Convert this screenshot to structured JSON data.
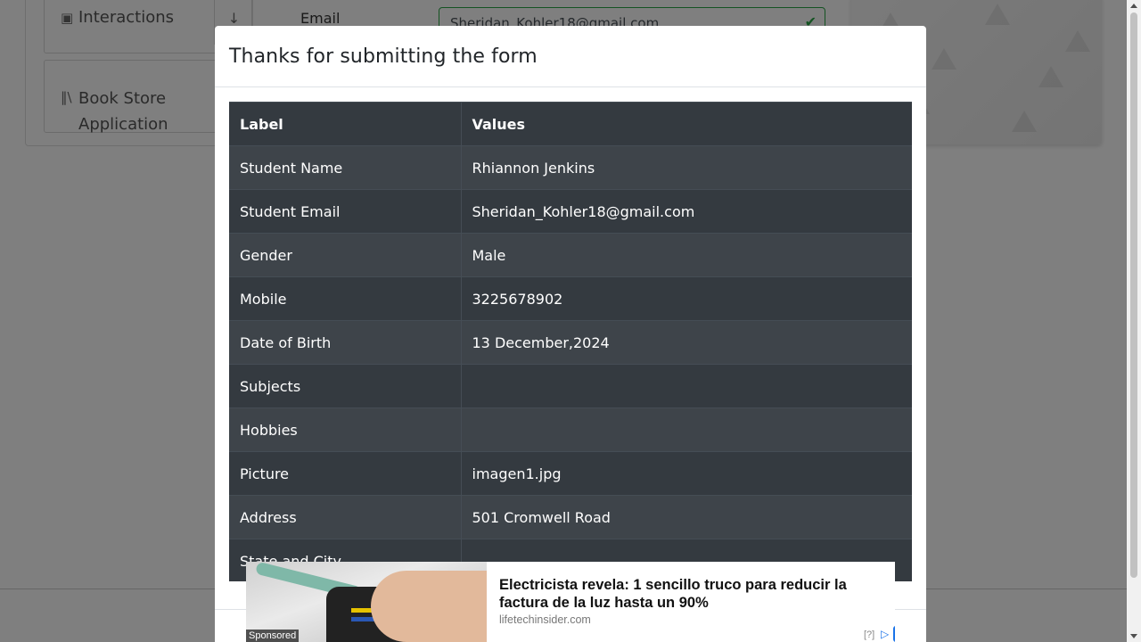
{
  "background": {
    "sidebar": {
      "groups": [
        {
          "label": "Interactions",
          "icon": "square-arrow-icon"
        },
        {
          "label": "Book Store Application",
          "icon": "books-icon"
        }
      ]
    },
    "form": {
      "email_label": "Email",
      "email_value": "Sheridan_Kohler18@gmail.com"
    }
  },
  "modal": {
    "title": "Thanks for submitting the form",
    "table": {
      "headers": [
        "Label",
        "Values"
      ],
      "rows": [
        {
          "label": "Student Name",
          "value": "Rhiannon Jenkins"
        },
        {
          "label": "Student Email",
          "value": "Sheridan_Kohler18@gmail.com"
        },
        {
          "label": "Gender",
          "value": "Male"
        },
        {
          "label": "Mobile",
          "value": "3225678902"
        },
        {
          "label": "Date of Birth",
          "value": "13 December,2024"
        },
        {
          "label": "Subjects",
          "value": ""
        },
        {
          "label": "Hobbies",
          "value": ""
        },
        {
          "label": "Picture",
          "value": "imagen1.jpg"
        },
        {
          "label": "Address",
          "value": "501 Cromwell Road"
        },
        {
          "label": "State and City",
          "value": ""
        }
      ]
    }
  },
  "ad": {
    "sponsored": "Sponsored",
    "headline": "Electricista revela: 1 sencillo truco para reducir la factura de la luz hasta un 90%",
    "domain": "lifetechinsider.com",
    "help": "[?]"
  },
  "colors": {
    "table_dark": "#343a40",
    "table_stripe": "#3e444a",
    "valid_green": "#28a745",
    "ad_blue": "#1a73e8"
  }
}
